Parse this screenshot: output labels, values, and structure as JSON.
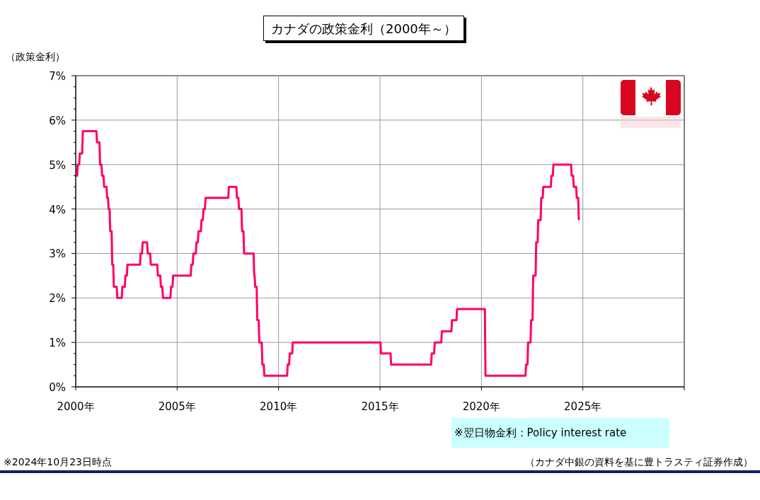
{
  "chart": {
    "chart_data": {
      "type": "line",
      "grid": true,
      "title": "カナダの政策金利（2000年～）",
      "ylabel": "（政策金利）",
      "xlim": [
        2000,
        2030
      ],
      "ylim": [
        0,
        7
      ],
      "xticks": [
        {
          "value": 2000,
          "label": "2000年"
        },
        {
          "value": 2005,
          "label": "2005年"
        },
        {
          "value": 2010,
          "label": "2010年"
        },
        {
          "value": 2015,
          "label": "2015年"
        },
        {
          "value": 2020,
          "label": "2020年"
        },
        {
          "value": 2025,
          "label": "2025年"
        }
      ],
      "yticks": [
        {
          "value": 0,
          "label": "0%"
        },
        {
          "value": 1,
          "label": "1%"
        },
        {
          "value": 2,
          "label": "2%"
        },
        {
          "value": 3,
          "label": "3%"
        },
        {
          "value": 4,
          "label": "4%"
        },
        {
          "value": 5,
          "label": "5%"
        },
        {
          "value": 6,
          "label": "6%"
        },
        {
          "value": 7,
          "label": "7%"
        }
      ],
      "x": [
        2000.0,
        2000.07,
        2000.1,
        2000.17,
        2000.2,
        2000.32,
        2000.35,
        2001.02,
        2001.05,
        2001.17,
        2001.2,
        2001.27,
        2001.3,
        2001.37,
        2001.4,
        2001.52,
        2001.55,
        2001.59,
        2001.62,
        2001.67,
        2001.7,
        2001.77,
        2001.8,
        2001.85,
        2001.88,
        2002.02,
        2002.05,
        2002.27,
        2002.3,
        2002.42,
        2002.45,
        2002.52,
        2002.55,
        2003.17,
        2003.2,
        2003.27,
        2003.3,
        2003.52,
        2003.55,
        2003.67,
        2003.7,
        2004.02,
        2004.05,
        2004.17,
        2004.2,
        2004.27,
        2004.3,
        2004.67,
        2004.7,
        2004.77,
        2004.8,
        2005.67,
        2005.7,
        2005.77,
        2005.8,
        2005.92,
        2005.95,
        2006.02,
        2006.05,
        2006.17,
        2006.2,
        2006.27,
        2006.3,
        2006.37,
        2006.4,
        2007.52,
        2007.55,
        2007.92,
        2007.95,
        2008.02,
        2008.05,
        2008.17,
        2008.2,
        2008.27,
        2008.3,
        2008.77,
        2008.8,
        2008.82,
        2008.85,
        2008.92,
        2008.95,
        2009.02,
        2009.05,
        2009.17,
        2009.2,
        2009.27,
        2009.3,
        2010.42,
        2010.45,
        2010.52,
        2010.55,
        2010.67,
        2010.7,
        2015.02,
        2015.05,
        2015.52,
        2015.55,
        2017.52,
        2017.55,
        2017.67,
        2017.7,
        2018.02,
        2018.05,
        2018.52,
        2018.55,
        2018.77,
        2018.8,
        2020.17,
        2020.2,
        2022.17,
        2022.2,
        2022.27,
        2022.3,
        2022.42,
        2022.45,
        2022.52,
        2022.55,
        2022.67,
        2022.7,
        2022.77,
        2022.8,
        2022.92,
        2022.95,
        2023.02,
        2023.05,
        2023.42,
        2023.45,
        2023.52,
        2023.55,
        2024.42,
        2024.45,
        2024.52,
        2024.55,
        2024.67,
        2024.7,
        2024.77,
        2024.8
      ],
      "series": [
        {
          "name": "※翌日物金利：Policy interest rate",
          "color": "#ff0066",
          "values": [
            4.75,
            4.75,
            5.0,
            5.0,
            5.25,
            5.25,
            5.75,
            5.75,
            5.5,
            5.5,
            5.0,
            5.0,
            4.75,
            4.75,
            4.5,
            4.5,
            4.25,
            4.25,
            4.0,
            4.0,
            3.5,
            3.5,
            2.75,
            2.75,
            2.25,
            2.25,
            2.0,
            2.0,
            2.25,
            2.25,
            2.5,
            2.5,
            2.75,
            2.75,
            3.0,
            3.0,
            3.25,
            3.25,
            3.0,
            3.0,
            2.75,
            2.75,
            2.5,
            2.5,
            2.25,
            2.25,
            2.0,
            2.0,
            2.25,
            2.25,
            2.5,
            2.5,
            2.75,
            2.75,
            3.0,
            3.0,
            3.25,
            3.25,
            3.5,
            3.5,
            3.75,
            3.75,
            4.0,
            4.0,
            4.25,
            4.25,
            4.5,
            4.5,
            4.25,
            4.25,
            4.0,
            4.0,
            3.5,
            3.5,
            3.0,
            3.0,
            2.5,
            2.5,
            2.25,
            2.25,
            1.5,
            1.5,
            1.0,
            1.0,
            0.5,
            0.5,
            0.25,
            0.25,
            0.5,
            0.5,
            0.75,
            0.75,
            1.0,
            1.0,
            0.75,
            0.75,
            0.5,
            0.5,
            0.75,
            0.75,
            1.0,
            1.0,
            1.25,
            1.25,
            1.5,
            1.5,
            1.75,
            1.75,
            0.25,
            0.25,
            0.5,
            0.5,
            1.0,
            1.0,
            1.5,
            1.5,
            2.5,
            2.5,
            3.25,
            3.25,
            3.75,
            3.75,
            4.25,
            4.25,
            4.5,
            4.5,
            4.75,
            4.75,
            5.0,
            5.0,
            4.75,
            4.75,
            4.5,
            4.5,
            4.25,
            4.25,
            3.75
          ]
        }
      ]
    }
  },
  "footnote": "※2024年10月23日時点",
  "source": "（カナダ中銀の資料を基に豊トラスティ証券作成）"
}
